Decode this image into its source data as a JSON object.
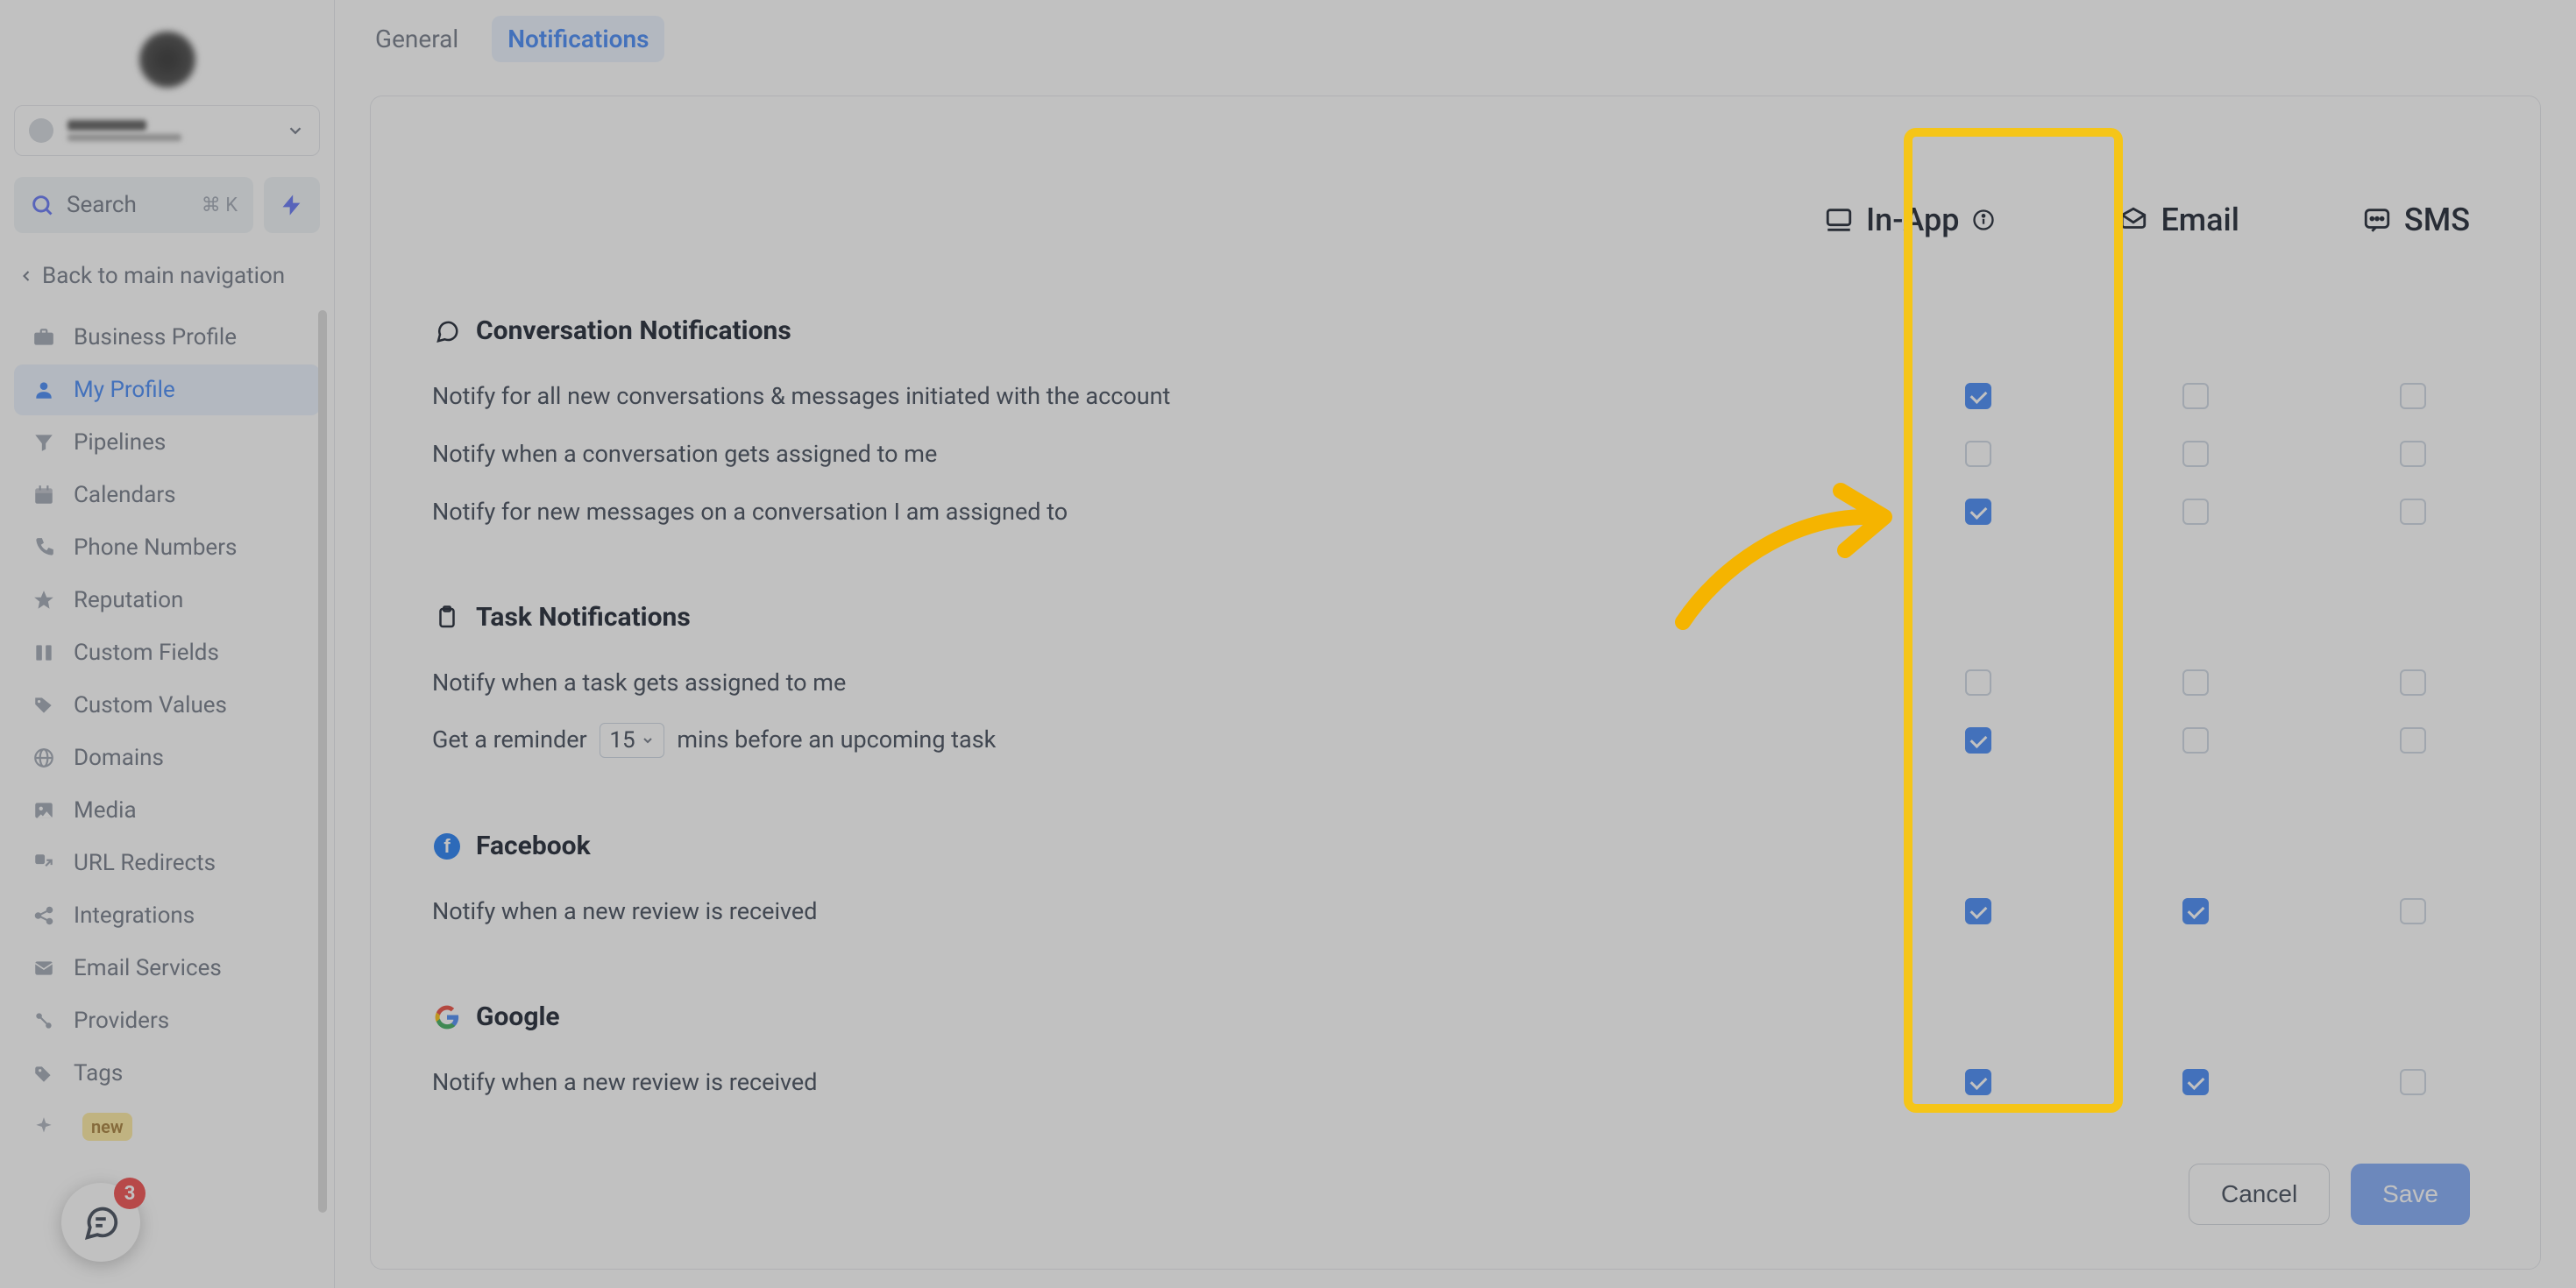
{
  "sidebar": {
    "search_label": "Search",
    "search_shortcut": "⌘ K",
    "back_label": "Back to main navigation",
    "items": [
      {
        "label": "Business Profile"
      },
      {
        "label": "My Profile"
      },
      {
        "label": "Pipelines"
      },
      {
        "label": "Calendars"
      },
      {
        "label": "Phone Numbers"
      },
      {
        "label": "Reputation"
      },
      {
        "label": "Custom Fields"
      },
      {
        "label": "Custom Values"
      },
      {
        "label": "Domains"
      },
      {
        "label": "Media"
      },
      {
        "label": "URL Redirects"
      },
      {
        "label": "Integrations"
      },
      {
        "label": "Email Services"
      },
      {
        "label": "Providers"
      },
      {
        "label": "Tags"
      }
    ],
    "badge_new": "new",
    "chat_badge": "3"
  },
  "tabs": {
    "general": "General",
    "notifications": "Notifications"
  },
  "channels": {
    "in_app": "In-App",
    "email": "Email",
    "sms": "SMS"
  },
  "sections": {
    "conversation": {
      "title": "Conversation Notifications",
      "rows": [
        {
          "label": "Notify for all new conversations & messages initiated with the account",
          "in_app": true,
          "email": false,
          "sms": false
        },
        {
          "label": "Notify when a conversation gets assigned to me",
          "in_app": false,
          "email": false,
          "sms": false
        },
        {
          "label": "Notify for new messages on a conversation I am assigned to",
          "in_app": true,
          "email": false,
          "sms": false
        }
      ]
    },
    "task": {
      "title": "Task Notifications",
      "rows": [
        {
          "label": "Notify when a task gets assigned to me",
          "in_app": false,
          "email": false,
          "sms": false
        }
      ],
      "reminder_prefix": "Get a reminder",
      "reminder_value": "15",
      "reminder_suffix": "mins before an upcoming task",
      "reminder_row": {
        "in_app": true,
        "email": false,
        "sms": false
      }
    },
    "facebook": {
      "title": "Facebook",
      "rows": [
        {
          "label": "Notify when a new review is received",
          "in_app": true,
          "email": true,
          "sms": false
        }
      ]
    },
    "google": {
      "title": "Google",
      "rows": [
        {
          "label": "Notify when a new review is received",
          "in_app": true,
          "email": true,
          "sms": false
        }
      ]
    }
  },
  "footer": {
    "cancel": "Cancel",
    "save": "Save"
  }
}
